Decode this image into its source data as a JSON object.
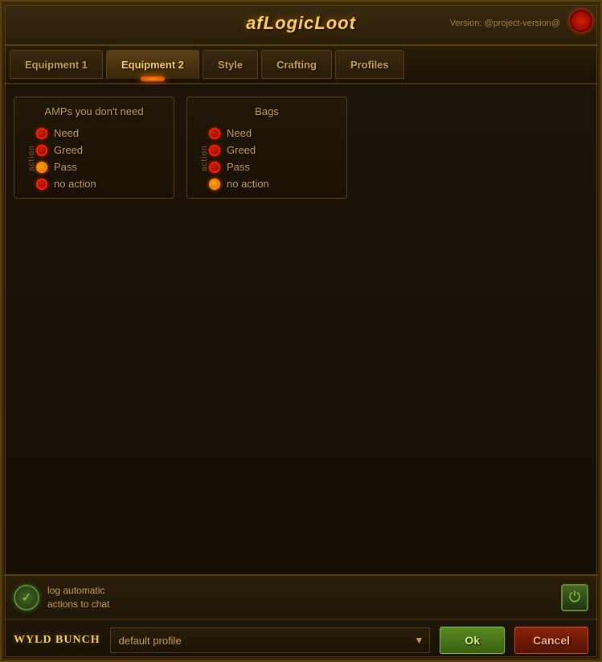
{
  "app": {
    "title": "afLogicLoot",
    "version_label": "Version: @project-version@",
    "close_icon": "●"
  },
  "tabs": [
    {
      "id": "equipment1",
      "label": "Equipment 1",
      "active": false
    },
    {
      "id": "equipment2",
      "label": "Equipment 2",
      "active": true
    },
    {
      "id": "style",
      "label": "Style",
      "active": false
    },
    {
      "id": "crafting",
      "label": "Crafting",
      "active": false
    },
    {
      "id": "profiles",
      "label": "Profiles",
      "active": false
    }
  ],
  "panels": {
    "amps": {
      "title": "AMPs you don't need",
      "action_label": "action",
      "items": [
        {
          "id": "need",
          "label": "Need",
          "state": "unselected"
        },
        {
          "id": "greed",
          "label": "Greed",
          "state": "unselected"
        },
        {
          "id": "pass",
          "label": "Pass",
          "state": "selected_orange"
        },
        {
          "id": "no_action",
          "label": "no action",
          "state": "unselected"
        }
      ]
    },
    "bags": {
      "title": "Bags",
      "action_label": "action",
      "items": [
        {
          "id": "need",
          "label": "Need",
          "state": "unselected"
        },
        {
          "id": "greed",
          "label": "Greed",
          "state": "unselected"
        },
        {
          "id": "pass",
          "label": "Pass",
          "state": "unselected"
        },
        {
          "id": "no_action",
          "label": "no action",
          "state": "selected_orange"
        }
      ]
    }
  },
  "bottom": {
    "log_text_line1": "log automatic",
    "log_text_line2": "actions to chat",
    "power_icon": "⏻"
  },
  "footer": {
    "guild_name": "Wyld Bunch",
    "profile_default": "default profile",
    "ok_label": "Ok",
    "cancel_label": "Cancel",
    "dropdown_arrow": "▼"
  }
}
